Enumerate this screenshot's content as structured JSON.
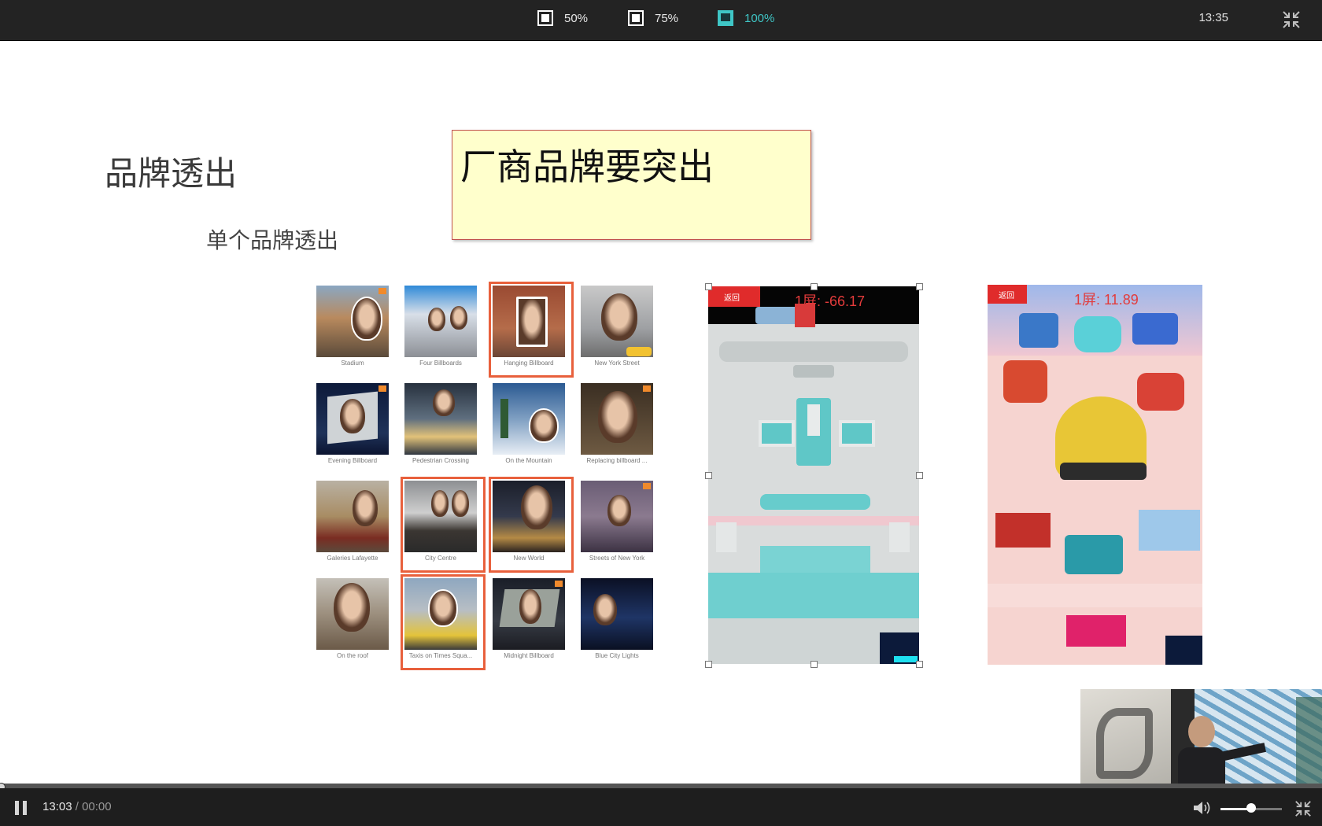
{
  "topbar": {
    "zoom_options": [
      {
        "label": "50%",
        "active": false
      },
      {
        "label": "75%",
        "active": false
      },
      {
        "label": "100%",
        "active": true
      }
    ],
    "clock": "13:35",
    "shrink_icon": "exit-fullscreen-icon"
  },
  "slide": {
    "title": "品牌透出",
    "subtitle": "单个品牌透出",
    "note": "厂商品牌要突出",
    "billboards": [
      {
        "caption": "Stadium"
      },
      {
        "caption": "Four Billboards"
      },
      {
        "caption": "Hanging Billboard"
      },
      {
        "caption": "New York Street"
      },
      {
        "caption": "Evening Billboard"
      },
      {
        "caption": "Pedestrian Crossing"
      },
      {
        "caption": "On the Mountain"
      },
      {
        "caption": "Replacing billboard ..."
      },
      {
        "caption": "Galeries Lafayette"
      },
      {
        "caption": "City Centre"
      },
      {
        "caption": "New World"
      },
      {
        "caption": "Streets of New York"
      },
      {
        "caption": "On the roof"
      },
      {
        "caption": "Taxis on Times Squa..."
      },
      {
        "caption": "Midnight Billboard"
      },
      {
        "caption": "Blue City Lights"
      }
    ],
    "phone1": {
      "back": "返回",
      "score": "1屏: -66.17"
    },
    "phone2": {
      "back": "返回",
      "score": "1屏: 11.89"
    }
  },
  "player": {
    "current_time": "13:03",
    "separator": " / ",
    "total_time": "00:00",
    "progress": 0.0,
    "volume": 0.5
  },
  "colors": {
    "accent": "#3fc6c6",
    "note_bg": "#ffffcc",
    "selection": "#e8603c"
  }
}
